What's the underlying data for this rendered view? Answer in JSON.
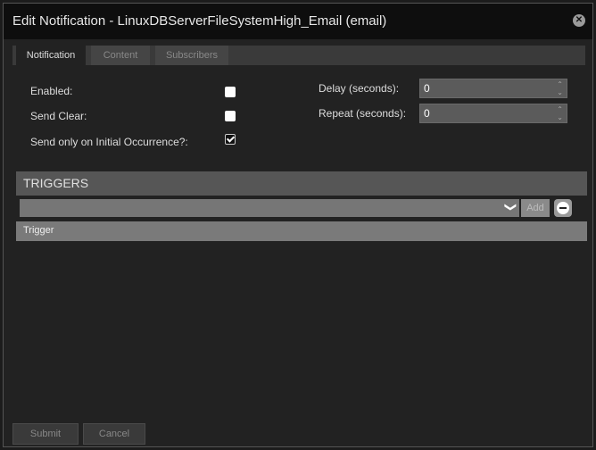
{
  "dialog": {
    "title": "Edit Notification - LinuxDBServerFileSystemHigh_Email (email)",
    "close_glyph": "✕"
  },
  "tabs": [
    {
      "label": "Notification",
      "active": true
    },
    {
      "label": "Content",
      "active": false
    },
    {
      "label": "Subscribers",
      "active": false
    }
  ],
  "form": {
    "enabled_label": "Enabled:",
    "enabled_checked": false,
    "send_clear_label": "Send Clear:",
    "send_clear_checked": false,
    "initial_only_label": "Send only on Initial Occurrence?:",
    "initial_only_checked": true,
    "delay_label": "Delay (seconds):",
    "delay_value": "0",
    "repeat_label": "Repeat (seconds):",
    "repeat_value": "0",
    "spinner_up": "⌃",
    "spinner_down": "⌄"
  },
  "triggers": {
    "header": "TRIGGERS",
    "select_chevron": "❯",
    "add_label": "Add",
    "column_header": "Trigger"
  },
  "footer": {
    "submit_label": "Submit",
    "cancel_label": "Cancel"
  },
  "colors": {
    "background": "#222222",
    "titlebar": "#0e0e0e",
    "section_header": "#565656",
    "column_header": "#7a7a7a"
  }
}
